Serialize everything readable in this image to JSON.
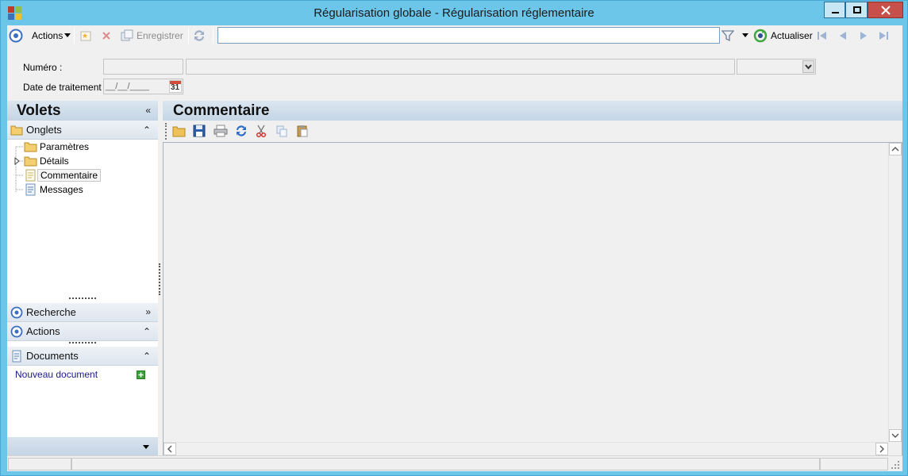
{
  "window": {
    "title": "Régularisation globale - Régularisation réglementaire"
  },
  "toolbar": {
    "actions_label": "Actions",
    "save_label": "Enregistrer",
    "search_value": "",
    "refresh_label": "Actualiser"
  },
  "form": {
    "numero_label": "Numéro :",
    "date_label": "Date de traitement :",
    "date_value": "__/__/____",
    "calendar_day": "31"
  },
  "left_panel": {
    "title": "Volets",
    "tabs_section": "Onglets",
    "tree": [
      {
        "label": "Paramètres",
        "icon": "folder-icon"
      },
      {
        "label": "Détails",
        "icon": "folder-icon"
      },
      {
        "label": "Commentaire",
        "icon": "document-icon"
      },
      {
        "label": "Messages",
        "icon": "document-icon"
      }
    ],
    "search_section": "Recherche",
    "actions_section": "Actions",
    "documents_section": "Documents",
    "new_document_label": "Nouveau document"
  },
  "main": {
    "title": "Commentaire"
  },
  "colors": {
    "titlebar": "#6cc6ea",
    "header_gradient": "#c5d6e6",
    "close_button": "#c7504a",
    "link_blue": "#1a1a8c"
  }
}
